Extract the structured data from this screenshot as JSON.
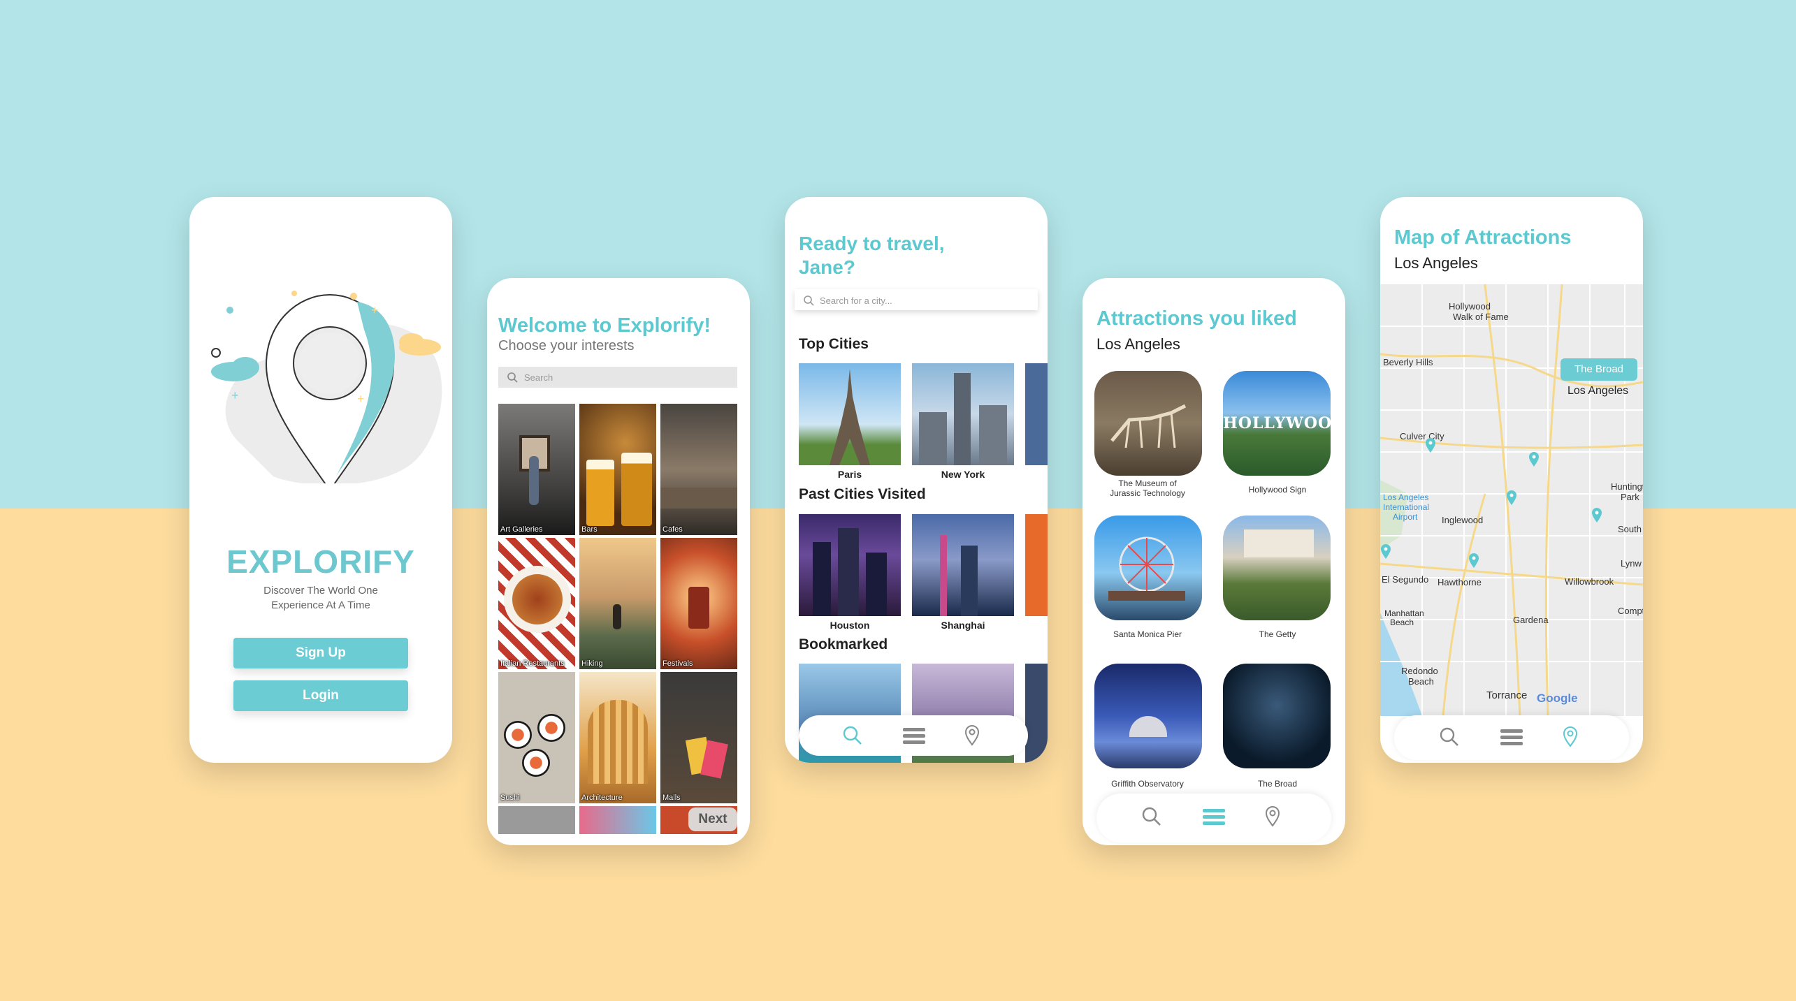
{
  "colors": {
    "teal": "#5cc8d0",
    "sky": "#b3e5e8",
    "sand": "#fddc9e",
    "dark": "#222222"
  },
  "screen1": {
    "brand": "EXPLORIFY",
    "tagline_1": "Discover The World One",
    "tagline_2": "Experience At A Time",
    "signup": "Sign Up",
    "login": "Login"
  },
  "screen2": {
    "title": "Welcome to Explorify!",
    "subtitle": "Choose your interests",
    "search_placeholder": "Search",
    "interests": [
      "Art Galleries",
      "Bars",
      "Cafes",
      "Italian Restaurants",
      "Hiking",
      "Festivals",
      "Sushi",
      "Architecture",
      "Malls"
    ],
    "next": "Next"
  },
  "screen3": {
    "title_1": "Ready to travel,",
    "title_2": "Jane?",
    "search_placeholder": "Search for a city...",
    "top_cities_heading": "Top Cities",
    "top_cities": [
      "Paris",
      "New York"
    ],
    "past_heading": "Past Cities Visited",
    "past_cities": [
      "Houston",
      "Shanghai"
    ],
    "bookmarked_heading": "Bookmarked"
  },
  "screen4": {
    "title": "Attractions you liked",
    "city": "Los Angeles",
    "attractions": [
      {
        "l1": "The Museum of",
        "l2": "Jurassic Technology"
      },
      {
        "l1": "Hollywood Sign",
        "l2": ""
      },
      {
        "l1": "Santa Monica Pier",
        "l2": ""
      },
      {
        "l1": "The Getty",
        "l2": ""
      },
      {
        "l1": "Griffith Observatory",
        "l2": ""
      },
      {
        "l1": "The Broad",
        "l2": ""
      }
    ],
    "hollywood_text": "HOLLYWOOD"
  },
  "screen5": {
    "title": "Map of Attractions",
    "city": "Los Angeles",
    "callout": "The Broad",
    "map_labels": {
      "hollywood": "Hollywood",
      "walk": "Walk of Fame",
      "beverly": "Beverly Hills",
      "la": "Los Angeles",
      "culver": "Culver City",
      "lax1": "Los Angeles",
      "lax2": "International",
      "lax3": "Airport",
      "inglewood": "Inglewood",
      "huntington1": "Huntingto",
      "huntington2": "Park",
      "south": "South",
      "elsegundo": "El Segundo",
      "hawthorne": "Hawthorne",
      "lynw": "Lynw",
      "willow": "Willowbrook",
      "manhattan1": "Manhattan",
      "manhattan2": "Beach",
      "gardena": "Gardena",
      "compt": "Compto",
      "redondo1": "Redondo",
      "redondo2": "Beach",
      "torrance": "Torrance",
      "google": "Google"
    }
  }
}
